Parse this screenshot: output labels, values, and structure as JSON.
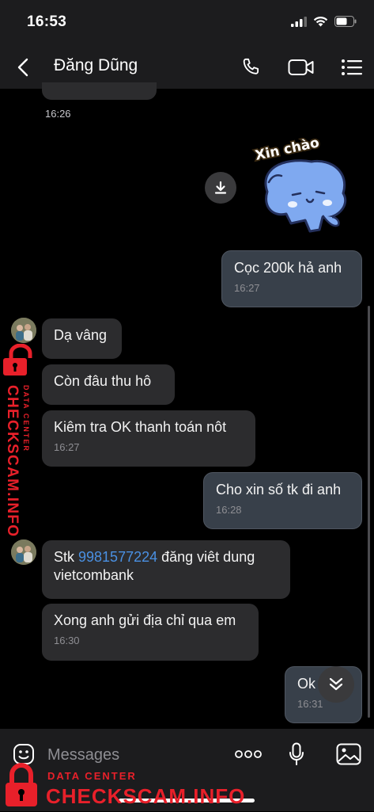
{
  "status_bar": {
    "time": "16:53"
  },
  "header": {
    "contact_name": "Đăng Dũng"
  },
  "messages": [
    {
      "time": "16:26"
    },
    {
      "text": "Cọc 200k hả anh",
      "time": "16:27"
    },
    {
      "text": "Dạ vâng"
    },
    {
      "text": "Còn đâu thu hô"
    },
    {
      "text": "Kiêm tra OK thanh toán nôt",
      "time": "16:27"
    },
    {
      "text": "Cho xin số tk đi anh",
      "time": "16:28"
    },
    {
      "text_before": "Stk ",
      "link": "9981577224",
      "text_after": " đăng viêt dung",
      "text_line2": "vietcombank"
    },
    {
      "text": "Xong anh gửi địa chỉ qua em",
      "time": "16:30"
    },
    {
      "text": "Ok",
      "time": "16:31"
    }
  ],
  "sticker": {
    "caption": "Xin chào"
  },
  "input": {
    "placeholder": "Messages"
  },
  "watermark": {
    "small": "DATA CENTER",
    "big": "CHECKSCAM.INFO"
  },
  "colors": {
    "outgoing_bubble": "#38404a",
    "incoming_bubble": "#2c2c2e",
    "link": "#4a90e2",
    "watermark": "#e8202a"
  }
}
